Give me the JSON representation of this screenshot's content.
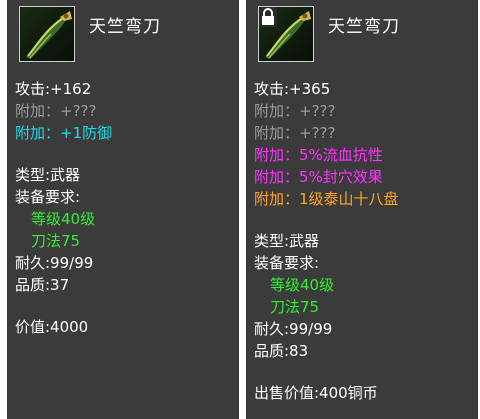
{
  "left_item": {
    "name": "天竺弯刀",
    "icon": "curved-sabre-icon",
    "attack": "攻击:+162",
    "bonus_lines": [
      {
        "text": "附加：+???",
        "color": "#9a9a9a"
      },
      {
        "text": "附加：+1防御",
        "color": "#22d8e8"
      }
    ],
    "type": "类型:武器",
    "requirement_title": "装备要求:",
    "requirements": [
      "等级40级",
      "刀法75"
    ],
    "durability": "耐久:99/99",
    "quality": "品质:37",
    "price": "价值:4000"
  },
  "right_item": {
    "name": "天竺弯刀",
    "icon": "curved-sabre-icon",
    "badge": "lock-icon",
    "attack": "攻击:+365",
    "bonus_lines": [
      {
        "text": "附加：+???",
        "color": "#9a9a9a"
      },
      {
        "text": "附加：+???",
        "color": "#9a9a9a"
      },
      {
        "text": "附加：5%流血抗性",
        "color": "#ff33ff"
      },
      {
        "text": "附加：5%封穴效果",
        "color": "#ff33ff"
      },
      {
        "text": "附加：1级泰山十八盘",
        "color": "#ffa526"
      }
    ],
    "type": "类型:武器",
    "requirement_title": "装备要求:",
    "requirements": [
      "等级40级",
      "刀法75"
    ],
    "durability": "耐久:99/99",
    "quality": "品质:83",
    "price": "出售价值:400铜币"
  }
}
